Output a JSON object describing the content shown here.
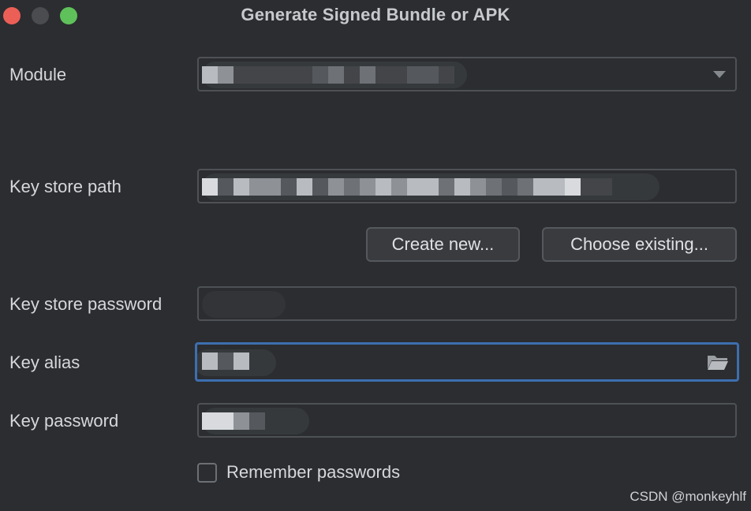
{
  "window": {
    "title": "Generate Signed Bundle or APK"
  },
  "form": {
    "module_label": "Module",
    "module_value": "",
    "key_store_path_label": "Key store path",
    "key_store_path_value": "",
    "create_new_label": "Create new...",
    "choose_existing_label": "Choose existing...",
    "key_store_password_label": "Key store password",
    "key_alias_label": "Key alias",
    "key_password_label": "Key password",
    "remember_passwords_label": "Remember passwords",
    "remember_passwords_checked": false
  },
  "watermark": "CSDN @monkeyhlf",
  "icons": {
    "dropdown": "chevron-down-icon",
    "browse": "folder-icon"
  },
  "colors": {
    "background": "#2b2d30",
    "focus_border": "#3d6fb0",
    "close": "#ec5f57",
    "maximize": "#5fc15a"
  }
}
